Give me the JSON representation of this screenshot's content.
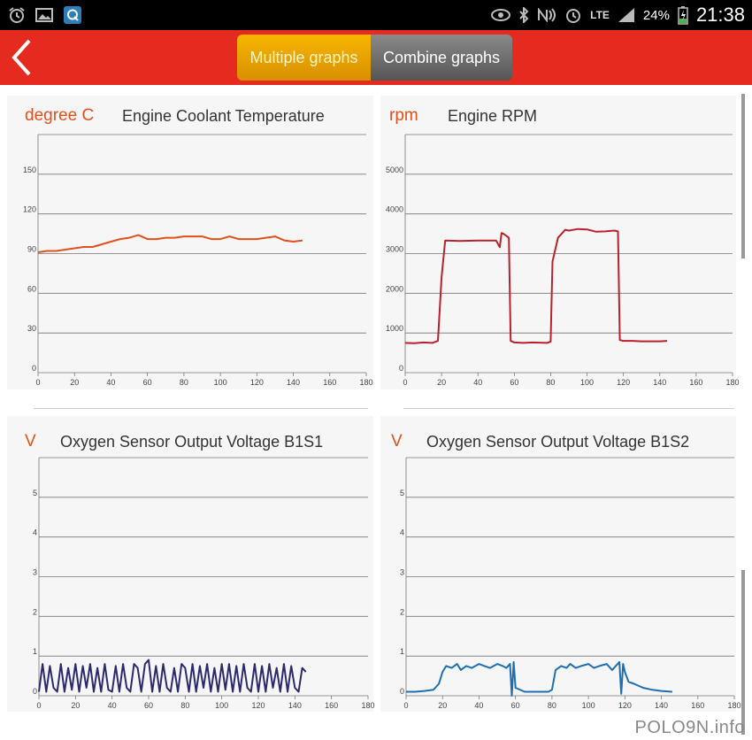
{
  "status_bar": {
    "battery_pct": "24%",
    "time": "21:38",
    "network": "LTE",
    "left_icons": [
      "alarm-icon",
      "gallery-icon",
      "q-app-icon"
    ],
    "right_icons": [
      "eye-icon",
      "bluetooth-icon",
      "nfc-icon",
      "alarm-clock-icon",
      "lte-icon",
      "signal-icon",
      "battery-charging-icon"
    ]
  },
  "action_bar": {
    "back_icon": "chevron-left-icon",
    "tab_multiple": "Multiple graphs",
    "tab_combine": "Combine graphs",
    "active_tab": "multiple",
    "color": "#e52b1f"
  },
  "panels": [
    {
      "unit": "degree C",
      "title": "Engine Coolant Temperature"
    },
    {
      "unit": "rpm",
      "title": "Engine RPM"
    },
    {
      "unit": "V",
      "title": "Oxygen Sensor Output Voltage B1S1"
    },
    {
      "unit": "V",
      "title": "Oxygen Sensor Output Voltage B1S2"
    }
  ],
  "chart_data": [
    {
      "type": "line",
      "title": "Engine Coolant Temperature",
      "ylabel": "degree C",
      "color": "#e0501c",
      "xlim": [
        0,
        180
      ],
      "ylim": [
        0,
        180
      ],
      "xticks": [
        0,
        20,
        40,
        60,
        80,
        100,
        120,
        140,
        160,
        180
      ],
      "yticks": [
        0,
        30,
        60,
        90,
        120,
        150
      ],
      "series": [
        {
          "x": [
            0,
            5,
            10,
            15,
            20,
            25,
            30,
            35,
            40,
            45,
            50,
            55,
            60,
            65,
            70,
            75,
            80,
            85,
            90,
            95,
            100,
            105,
            110,
            115,
            120,
            125,
            130,
            135,
            140,
            145
          ],
          "y": [
            91,
            92,
            92,
            93,
            94,
            95,
            95,
            97,
            99,
            101,
            102,
            104,
            101,
            101,
            102,
            102,
            103,
            103,
            103,
            101,
            101,
            103,
            101,
            101,
            101,
            102,
            103,
            100,
            99,
            100
          ]
        }
      ]
    },
    {
      "type": "line",
      "title": "Engine RPM",
      "ylabel": "rpm",
      "color": "#b8222c",
      "xlim": [
        0,
        180
      ],
      "ylim": [
        0,
        6000
      ],
      "xticks": [
        0,
        20,
        40,
        60,
        80,
        100,
        120,
        140,
        160,
        180
      ],
      "yticks": [
        0,
        1000,
        2000,
        3000,
        4000,
        5000
      ],
      "series": [
        {
          "x": [
            0,
            5,
            10,
            15,
            18,
            20,
            22,
            30,
            40,
            50,
            52,
            53,
            54,
            57,
            58,
            60,
            65,
            70,
            78,
            80,
            81,
            84,
            88,
            90,
            95,
            100,
            105,
            110,
            115,
            117,
            118,
            120,
            125,
            130,
            140,
            144
          ],
          "y": [
            750,
            740,
            760,
            750,
            800,
            2400,
            3330,
            3320,
            3330,
            3330,
            3160,
            3520,
            3500,
            3400,
            800,
            760,
            750,
            760,
            750,
            780,
            2800,
            3400,
            3600,
            3580,
            3620,
            3610,
            3550,
            3560,
            3580,
            3560,
            820,
            800,
            800,
            790,
            790,
            800
          ]
        }
      ]
    },
    {
      "type": "line",
      "title": "Oxygen Sensor Output Voltage B1S1",
      "ylabel": "V",
      "color": "#2c2a6e",
      "xlim": [
        0,
        180
      ],
      "ylim": [
        0,
        6
      ],
      "xticks": [
        0,
        20,
        40,
        60,
        80,
        100,
        120,
        140,
        160,
        180
      ],
      "yticks": [
        0,
        1,
        2,
        3,
        4,
        5
      ],
      "series": [
        {
          "x": [
            0,
            2,
            4,
            6,
            8,
            10,
            12,
            14,
            16,
            18,
            20,
            22,
            24,
            26,
            28,
            30,
            32,
            34,
            36,
            38,
            40,
            42,
            44,
            46,
            48,
            50,
            52,
            54,
            56,
            58,
            60,
            62,
            64,
            66,
            68,
            70,
            72,
            74,
            76,
            78,
            80,
            82,
            84,
            86,
            88,
            90,
            92,
            94,
            96,
            98,
            100,
            102,
            104,
            106,
            108,
            110,
            112,
            114,
            116,
            118,
            120,
            122,
            124,
            126,
            128,
            130,
            132,
            134,
            136,
            138,
            140,
            142,
            144,
            146
          ],
          "y": [
            0.1,
            0.8,
            0.1,
            0.75,
            0.2,
            0.1,
            0.8,
            0.1,
            0.7,
            0.15,
            0.8,
            0.1,
            0.75,
            0.2,
            0.8,
            0.1,
            0.7,
            0.1,
            0.8,
            0.15,
            0.1,
            0.75,
            0.1,
            0.8,
            0.2,
            0.1,
            0.8,
            0.7,
            0.1,
            0.8,
            0.9,
            0.1,
            0.75,
            0.1,
            0.8,
            0.2,
            0.1,
            0.7,
            0.1,
            0.8,
            0.7,
            0.1,
            0.8,
            0.1,
            0.75,
            0.2,
            0.8,
            0.1,
            0.7,
            0.1,
            0.8,
            0.15,
            0.8,
            0.1,
            0.75,
            0.1,
            0.8,
            0.2,
            0.1,
            0.8,
            0.1,
            0.75,
            0.1,
            0.8,
            0.2,
            0.7,
            0.1,
            0.8,
            0.1,
            0.75,
            0.2,
            0.1,
            0.7,
            0.6
          ]
        }
      ]
    },
    {
      "type": "line",
      "title": "Oxygen Sensor Output Voltage B1S2",
      "ylabel": "V",
      "color": "#1f6fb0",
      "xlim": [
        0,
        180
      ],
      "ylim": [
        0,
        6
      ],
      "xticks": [
        0,
        20,
        40,
        60,
        80,
        100,
        120,
        140,
        160,
        180
      ],
      "yticks": [
        0,
        1,
        2,
        3,
        4,
        5
      ],
      "series": [
        {
          "x": [
            0,
            5,
            10,
            15,
            18,
            20,
            22,
            25,
            28,
            30,
            33,
            36,
            40,
            43,
            46,
            50,
            53,
            55,
            57,
            58,
            59,
            60,
            65,
            70,
            75,
            78,
            80,
            82,
            85,
            88,
            90,
            93,
            96,
            100,
            103,
            106,
            110,
            113,
            115,
            117,
            118,
            119,
            120,
            122,
            125,
            130,
            135,
            140,
            146
          ],
          "y": [
            0.1,
            0.1,
            0.12,
            0.15,
            0.3,
            0.6,
            0.75,
            0.7,
            0.8,
            0.65,
            0.75,
            0.7,
            0.8,
            0.75,
            0.7,
            0.8,
            0.75,
            0.7,
            0.8,
            0.0,
            0.85,
            0.2,
            0.1,
            0.1,
            0.1,
            0.1,
            0.15,
            0.65,
            0.75,
            0.7,
            0.8,
            0.7,
            0.75,
            0.8,
            0.7,
            0.75,
            0.8,
            0.65,
            0.75,
            0.85,
            0.05,
            0.8,
            0.6,
            0.35,
            0.3,
            0.2,
            0.15,
            0.12,
            0.1
          ]
        }
      ]
    }
  ],
  "watermark": "POLO9N.info"
}
